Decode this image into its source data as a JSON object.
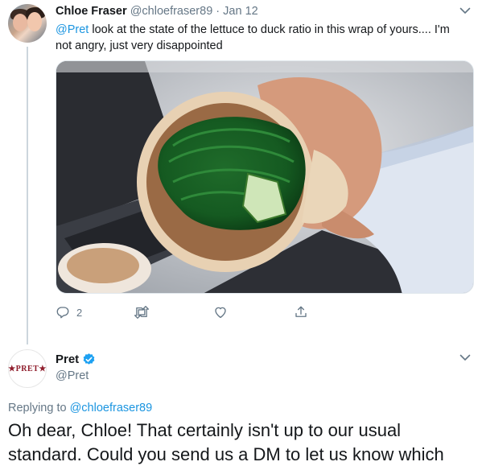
{
  "tweet1": {
    "display_name": "Chloe Fraser",
    "handle": "@chloefraser89",
    "separator": "·",
    "date": "Jan 12",
    "mention": "@Pret",
    "text": " look at the state of the lettuce to duck ratio in this wrap of yours.... I'm not angry, just very disappointed",
    "actions": {
      "reply_icon": "reply-icon",
      "reply_count": "2",
      "retweet_icon": "retweet-icon",
      "like_icon": "heart-icon",
      "share_icon": "share-icon"
    }
  },
  "tweet2": {
    "display_name": "Pret",
    "handle": "@Pret",
    "avatar_logo_text": "★PRET★",
    "verified_icon": "verified-badge-icon",
    "replying_prefix": "Replying to ",
    "replying_to": "@chloefraser89",
    "text": "Oh dear, Chloe! That certainly isn't up to our usual standard. Could you send us a DM to let us know which"
  },
  "colors": {
    "link": "#1b95e0",
    "muted": "#657786",
    "pret_brand": "#8f1d2c",
    "thread_line": "#ccd6dd"
  }
}
